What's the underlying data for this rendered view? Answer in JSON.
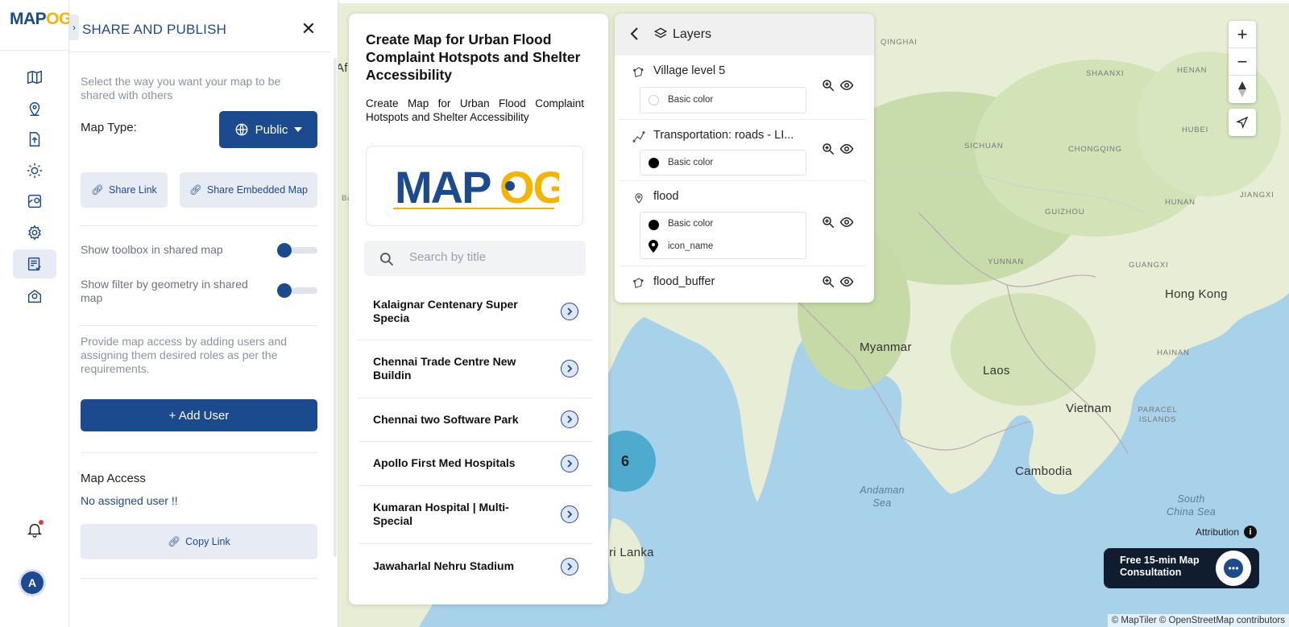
{
  "app": {
    "logo_left": "MAP",
    "logo_right": "OG"
  },
  "rail": {
    "icons": [
      "map-icon",
      "location-pin-icon",
      "upload-icon",
      "sun-icon",
      "map-settings-icon",
      "gear-icon",
      "share-list-icon",
      "map-pin-globe-icon"
    ],
    "active_index": 6,
    "avatar_letter": "A"
  },
  "share": {
    "title": "SHARE AND PUBLISH",
    "intro": "Select the way you want your map to be shared with others",
    "map_type_label": "Map Type:",
    "map_type_value": "Public",
    "share_link": "Share Link",
    "share_embedded": "Share Embedded Map",
    "toggle_toolbox": "Show toolbox in shared map",
    "toggle_filter": "Show filter by geometry in shared map",
    "access_text": "Provide map access by adding users and assigning them desired roles as per the requirements.",
    "add_user": "+ Add User",
    "map_access_title": "Map Access",
    "no_user": "No assigned user !!",
    "copy_link": "Copy Link"
  },
  "story": {
    "title": "Create Map for Urban Flood Complaint Hotspots and Shelter Accessibility",
    "description": "Create Map for Urban Flood Complaint Hotspots and Shelter Accessibility",
    "search_placeholder": "Search by title",
    "items": [
      {
        "name": "Kalaignar Centenary Super Specia"
      },
      {
        "name": "Chennai Trade Centre New Buildin"
      },
      {
        "name": "Chennai two Software Park"
      },
      {
        "name": "Apollo First Med Hospitals"
      },
      {
        "name": "Kumaran Hospital | Multi-Special"
      },
      {
        "name": "Jawaharlal Nehru Stadium"
      }
    ]
  },
  "layers": {
    "title": "Layers",
    "items": [
      {
        "name": "Village level 5",
        "legend": [
          {
            "label": "Basic color",
            "color": "#ffffff"
          }
        ]
      },
      {
        "name": "Transportation: roads - LI...",
        "legend": [
          {
            "label": "Basic color",
            "color": "#000000"
          }
        ]
      },
      {
        "name": "flood",
        "legend": [
          {
            "label": "Basic color",
            "color": "#000000"
          },
          {
            "label": "icon_name",
            "color": "#000000"
          }
        ]
      },
      {
        "name": "flood_buffer",
        "legend": []
      }
    ]
  },
  "map": {
    "cluster_count": "6",
    "labels": {
      "myanmar": "Myanmar",
      "laos": "Laos",
      "vietnam": "Vietnam",
      "cambodia": "Cambodia",
      "hong_kong": "Hong Kong",
      "sri_lanka": "ri Lanka",
      "andaman_sea": "Andaman Sea",
      "south_china_sea": "South China Sea",
      "qinghai": "QINGHAI",
      "shaanxi": "SHAANXI",
      "henan": "HENAN",
      "hubei": "HUBEI",
      "sichuan": "SICHUAN",
      "chongqing": "CHONGQING",
      "guizhou": "GUIZHOU",
      "hunan": "HUNAN",
      "jiangxi": "JIANGXI",
      "yunnan": "YUNNAN",
      "guangxi": "GUANGXI",
      "hainan": "HAINAN",
      "paracel": "PARACEL ISLANDS",
      "af": "Af",
      "ba": "Ba"
    },
    "attribution": "Attribution",
    "copyright": "© MapTiler © OpenStreetMap contributors",
    "consult_line1": "Free 15-min Map",
    "consult_line2": "Consultation"
  },
  "colors": {
    "primary": "#1b4a8f",
    "accent": "#f5b400",
    "land": "#e9efd9",
    "water": "#a8d1ea"
  }
}
